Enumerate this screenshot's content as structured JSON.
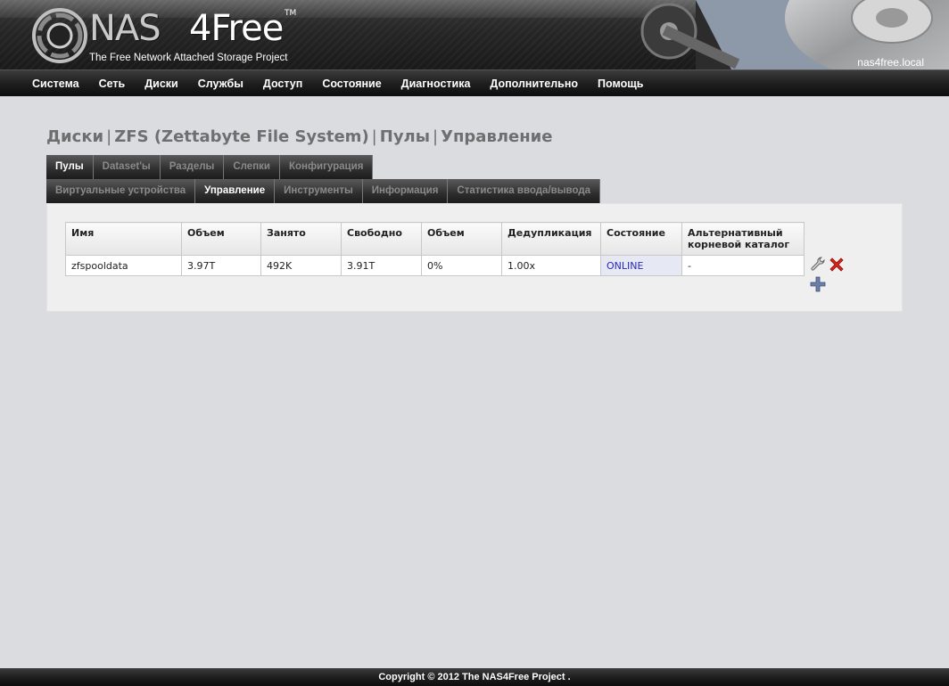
{
  "header": {
    "logo_nas": "NAS",
    "logo_free": "4Free",
    "logo_tm": "TM",
    "tagline": "The Free Network Attached Storage Project",
    "hostname": "nas4free.local"
  },
  "nav": {
    "items": [
      {
        "label": "Система"
      },
      {
        "label": "Сеть"
      },
      {
        "label": "Диски"
      },
      {
        "label": "Службы"
      },
      {
        "label": "Доступ"
      },
      {
        "label": "Состояние"
      },
      {
        "label": "Диагностика"
      },
      {
        "label": "Дополнительно"
      },
      {
        "label": "Помощь"
      }
    ]
  },
  "page_title": {
    "parts": [
      "Диски",
      "ZFS (Zettabyte File System)",
      "Пулы",
      "Управление"
    ],
    "separator": "|"
  },
  "tabs_row1": [
    {
      "label": "Пулы",
      "active": true
    },
    {
      "label": "Dataset'ы",
      "active": false
    },
    {
      "label": "Разделы",
      "active": false
    },
    {
      "label": "Слепки",
      "active": false
    },
    {
      "label": "Конфигурация",
      "active": false
    }
  ],
  "tabs_row2": [
    {
      "label": "Виртуальные устройства",
      "active": false
    },
    {
      "label": "Управление",
      "active": true
    },
    {
      "label": "Инструменты",
      "active": false
    },
    {
      "label": "Информация",
      "active": false
    },
    {
      "label": "Статистика ввода/вывода",
      "active": false
    }
  ],
  "table": {
    "headers": [
      "Имя",
      "Объем",
      "Занято",
      "Свободно",
      "Объем",
      "Дедупликация",
      "Состояние",
      "Альтернативный корневой каталог"
    ],
    "rows": [
      [
        "zfspooldata",
        "3.97T",
        "492K",
        "3.91T",
        "0%",
        "1.00x",
        "ONLINE",
        "-"
      ]
    ]
  },
  "actions": {
    "edit_icon": "wrench-icon",
    "delete_icon": "delete-x-icon",
    "add_icon": "add-plus-icon"
  },
  "footer": {
    "copyright": "Copyright © 2012 The NAS4Free Project ."
  },
  "colors": {
    "background": "#dadce0",
    "status_online_bg": "#e6e8f3",
    "status_online_text": "#2a2ab8",
    "title_gray": "#6f6f6f"
  }
}
